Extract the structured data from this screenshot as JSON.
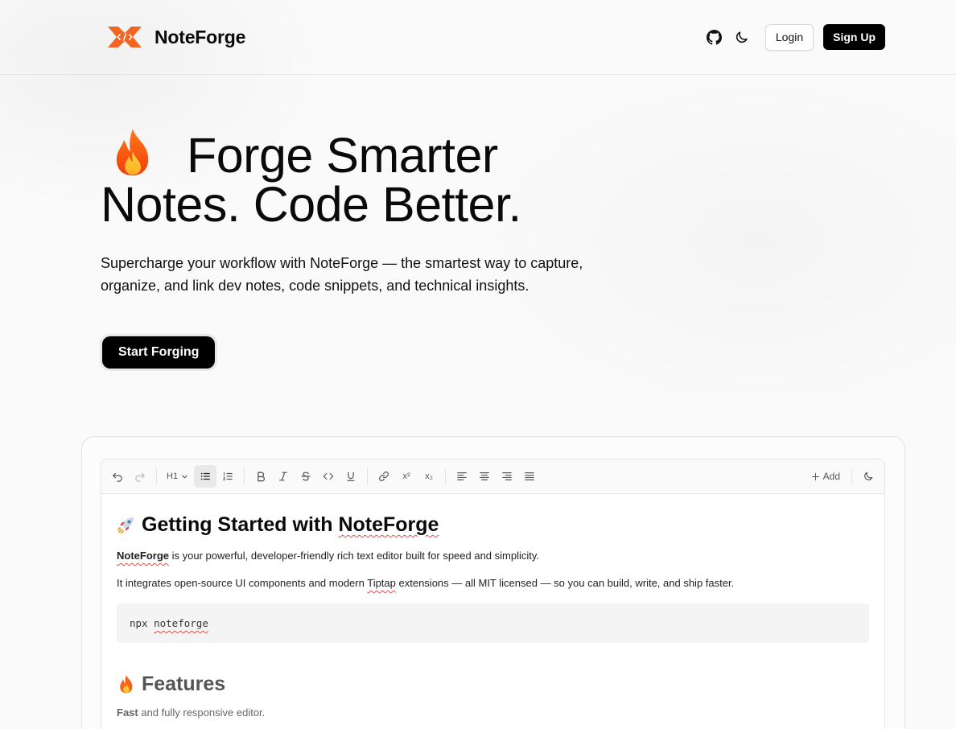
{
  "brand": {
    "name": "NoteForge",
    "accent": "#f26522"
  },
  "header": {
    "github_icon": "github-icon",
    "theme_icon": "moon-icon",
    "login_label": "Login",
    "signup_label": "Sign Up"
  },
  "hero": {
    "title_line1": "Forge Smarter",
    "title_line2": "Notes. Code Better.",
    "title_emoji": "flame",
    "subtitle_line1": "Supercharge your workflow with NoteForge — the smartest way to capture,",
    "subtitle_line2": "organize, and link dev notes, code snippets, and technical insights.",
    "cta_label": "Start Forging"
  },
  "editor": {
    "toolbar": {
      "heading_label": "H1",
      "add_label": "Add",
      "superscript_label": "x²",
      "subscript_label": "x₂"
    },
    "doc": {
      "h1_prefix": "Getting Started with ",
      "h1_brand": "NoteForge",
      "p1_bold": "NoteForge",
      "p1_rest": " is your powerful, developer-friendly rich text editor built for speed and simplicity.",
      "p2_before": "It integrates open-source UI components and modern ",
      "p2_link": "Tiptap",
      "p2_after": " extensions — all MIT licensed — so you can build, write, and ship faster.",
      "code_cmd": "npx",
      "code_arg": "noteforge",
      "h2": "Features",
      "p3_bold": "Fast",
      "p3_rest": " and fully responsive editor."
    }
  }
}
